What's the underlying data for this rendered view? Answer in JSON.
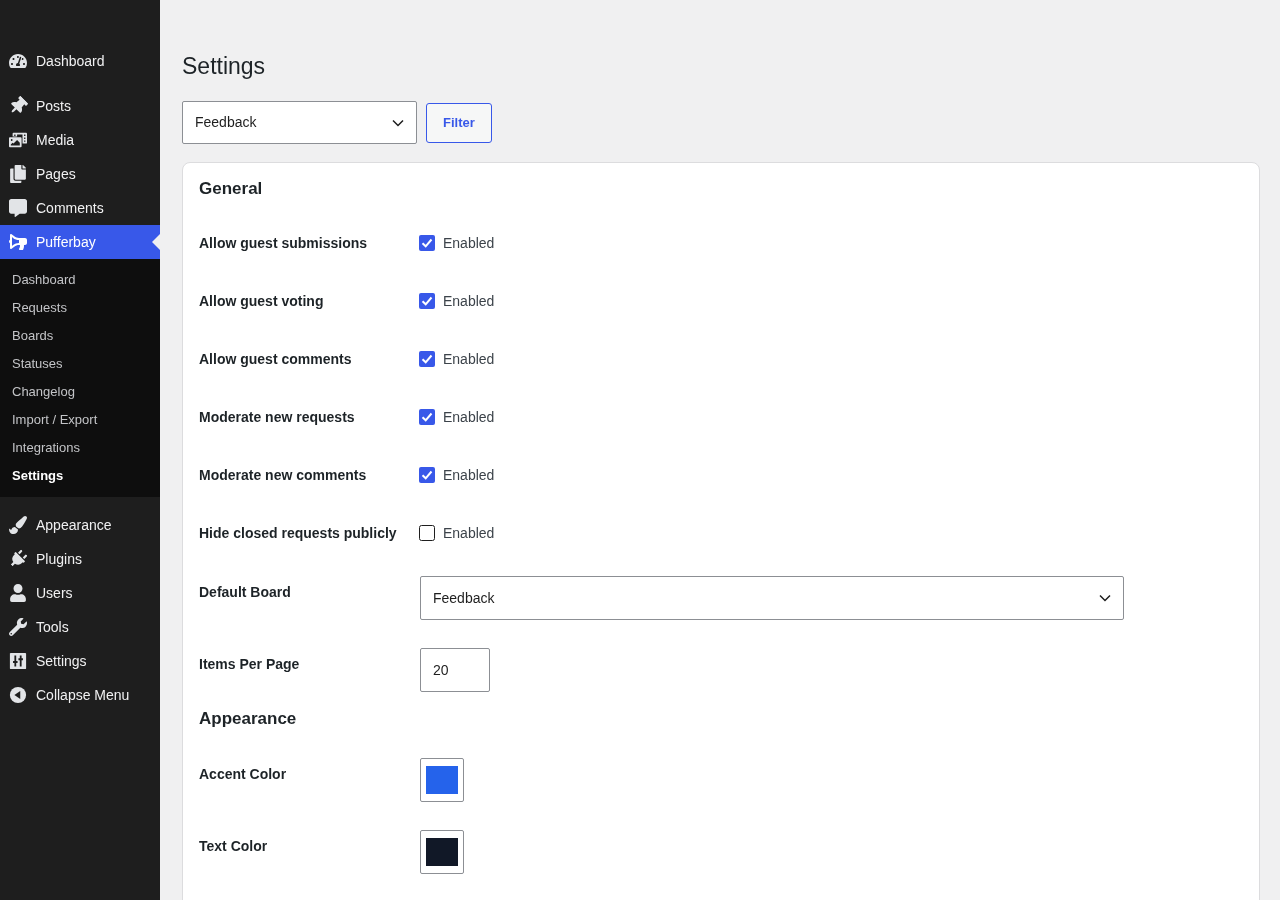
{
  "sidebar": {
    "groups": [
      {
        "items": [
          {
            "label": "Dashboard",
            "selected": false
          }
        ]
      },
      {
        "items": [
          {
            "label": "Posts",
            "selected": false
          },
          {
            "label": "Media",
            "selected": false
          },
          {
            "label": "Pages",
            "selected": false
          },
          {
            "label": "Comments",
            "selected": false
          },
          {
            "label": "Pufferbay",
            "selected": true,
            "children": [
              {
                "label": "Dashboard",
                "selected": false
              },
              {
                "label": "Requests",
                "selected": false
              },
              {
                "label": "Boards",
                "selected": false
              },
              {
                "label": "Statuses",
                "selected": false
              },
              {
                "label": "Changelog",
                "selected": false
              },
              {
                "label": "Import / Export",
                "selected": false
              },
              {
                "label": "Integrations",
                "selected": false
              },
              {
                "label": "Settings",
                "selected": true
              }
            ]
          }
        ]
      },
      {
        "items": [
          {
            "label": "Appearance",
            "selected": false
          },
          {
            "label": "Plugins",
            "selected": false
          },
          {
            "label": "Users",
            "selected": false
          },
          {
            "label": "Tools",
            "selected": false
          },
          {
            "label": "Settings",
            "selected": false
          },
          {
            "label": "Collapse Menu",
            "selected": false
          }
        ]
      }
    ]
  },
  "page_title": "Settings",
  "filter_bar": {
    "board_select": {
      "value": "Feedback"
    },
    "filter_button": "Filter"
  },
  "sections": [
    {
      "title": "General",
      "rows": [
        {
          "kind": "checkbox",
          "label": "Allow guest submissions",
          "checked": true,
          "option": "Enabled"
        },
        {
          "kind": "checkbox",
          "label": "Allow guest voting",
          "checked": true,
          "option": "Enabled"
        },
        {
          "kind": "checkbox",
          "label": "Allow guest comments",
          "checked": true,
          "option": "Enabled"
        },
        {
          "kind": "checkbox",
          "label": "Moderate new requests",
          "checked": true,
          "option": "Enabled"
        },
        {
          "kind": "checkbox",
          "label": "Moderate new comments",
          "checked": true,
          "option": "Enabled"
        },
        {
          "kind": "checkbox",
          "label": "Hide closed requests publicly",
          "checked": false,
          "option": "Enabled"
        },
        {
          "kind": "select",
          "label": "Default Board",
          "value": "Feedback"
        },
        {
          "kind": "number",
          "label": "Items Per Page",
          "value": "20"
        }
      ]
    },
    {
      "title": "Appearance",
      "rows": [
        {
          "kind": "color",
          "label": "Accent Color",
          "color": "#2563eb"
        },
        {
          "kind": "color",
          "label": "Text Color",
          "color": "#111827"
        }
      ]
    }
  ]
}
